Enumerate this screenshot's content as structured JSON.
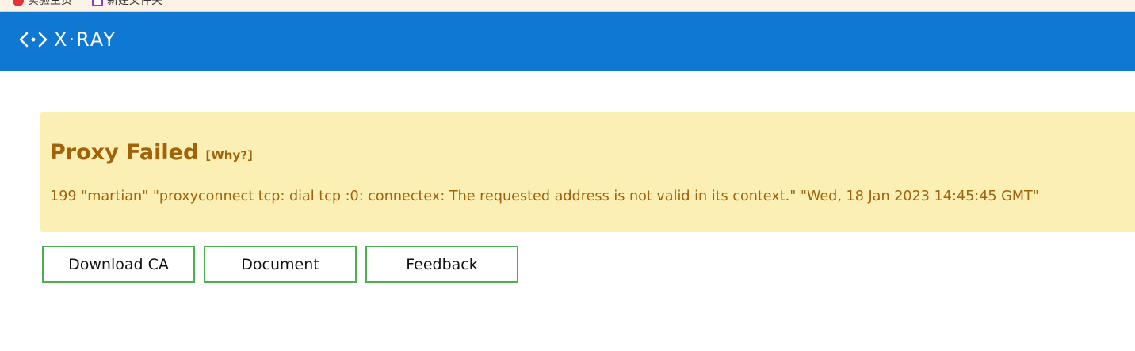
{
  "bookmarks_bar": {
    "items": [
      {
        "label": "实验主页",
        "icon": "red-circle-icon"
      },
      {
        "label": "新建文件夹",
        "icon": "purple-folder-icon"
      }
    ]
  },
  "header": {
    "logo_text": "X·RAY",
    "logo_icon": "code-brackets-icon",
    "background_color": "#0e78d2"
  },
  "alert": {
    "title": "Proxy Failed",
    "why_link": "[Why?]",
    "message": "199 \"martian\" \"proxyconnect tcp: dial tcp :0: connectex: The requested address is not valid in its context.\" \"Wed, 18 Jan 2023 14:45:45 GMT\"",
    "background_color": "#fcefb4",
    "text_color": "#a0620a"
  },
  "actions": {
    "download_ca": "Download CA",
    "document": "Document",
    "feedback": "Feedback",
    "border_color": "#4caf50"
  }
}
